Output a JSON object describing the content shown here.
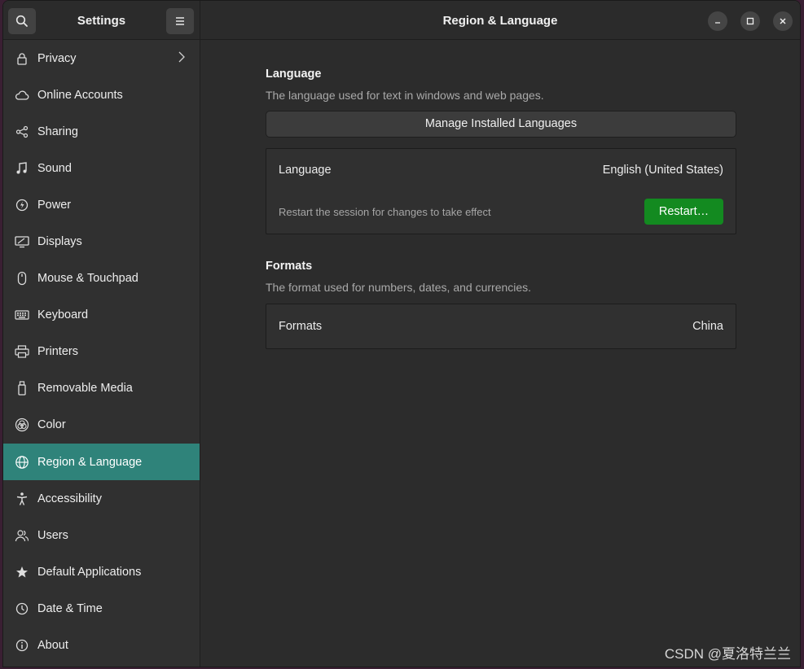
{
  "sidebar": {
    "title": "Settings",
    "items": [
      {
        "label": "Privacy",
        "icon": "lock-icon",
        "chevron": true
      },
      {
        "label": "Online Accounts",
        "icon": "cloud-icon"
      },
      {
        "label": "Sharing",
        "icon": "share-icon"
      },
      {
        "label": "Sound",
        "icon": "music-note-icon"
      },
      {
        "label": "Power",
        "icon": "power-icon"
      },
      {
        "label": "Displays",
        "icon": "display-icon"
      },
      {
        "label": "Mouse & Touchpad",
        "icon": "mouse-icon"
      },
      {
        "label": "Keyboard",
        "icon": "keyboard-icon"
      },
      {
        "label": "Printers",
        "icon": "printer-icon"
      },
      {
        "label": "Removable Media",
        "icon": "usb-drive-icon"
      },
      {
        "label": "Color",
        "icon": "color-icon"
      },
      {
        "label": "Region & Language",
        "icon": "globe-icon",
        "active": true
      },
      {
        "label": "Accessibility",
        "icon": "accessibility-icon"
      },
      {
        "label": "Users",
        "icon": "users-icon"
      },
      {
        "label": "Default Applications",
        "icon": "star-icon"
      },
      {
        "label": "Date & Time",
        "icon": "clock-icon"
      },
      {
        "label": "About",
        "icon": "info-icon"
      }
    ]
  },
  "header": {
    "title": "Region & Language"
  },
  "language": {
    "title": "Language",
    "description": "The language used for text in windows and web pages.",
    "manage_button": "Manage Installed Languages",
    "row_label": "Language",
    "row_value": "English (United States)",
    "restart_note": "Restart the session for changes to take effect",
    "restart_button": "Restart…"
  },
  "formats": {
    "title": "Formats",
    "description": "The format used for numbers, dates, and currencies.",
    "row_label": "Formats",
    "row_value": "China"
  },
  "watermark": "CSDN @夏洛特兰兰",
  "colors": {
    "accent": "#2f837a",
    "restart": "#138a20"
  }
}
